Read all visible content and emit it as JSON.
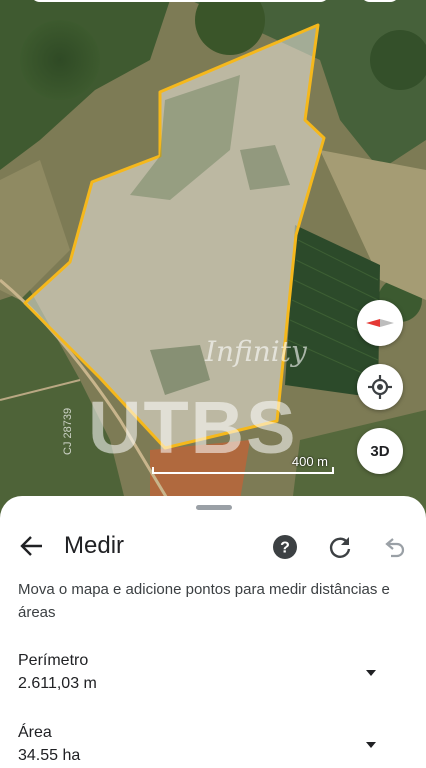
{
  "map": {
    "scale_label": "400 m",
    "watermark_brand": "UTBS",
    "watermark_script": "Infinity",
    "watermark_code": "CJ 28739",
    "button_3d_label": "3D",
    "colors": {
      "polygon_stroke": "#f5b81c",
      "polygon_fill": "rgba(255,255,255,0.35)"
    }
  },
  "sheet": {
    "title": "Medir",
    "instructions": "Mova o mapa e adicione pontos para medir distâncias e áreas",
    "perimeter": {
      "label": "Perímetro",
      "value": "2.611,03 m"
    },
    "area": {
      "label": "Área",
      "value": "34.55 ha"
    },
    "icons": {
      "back": "arrow-back-icon",
      "help": "help-icon",
      "refresh": "refresh-icon",
      "undo": "undo-icon",
      "caret": "caret-down-icon",
      "compass": "compass-icon",
      "locate": "my-location-icon"
    }
  }
}
